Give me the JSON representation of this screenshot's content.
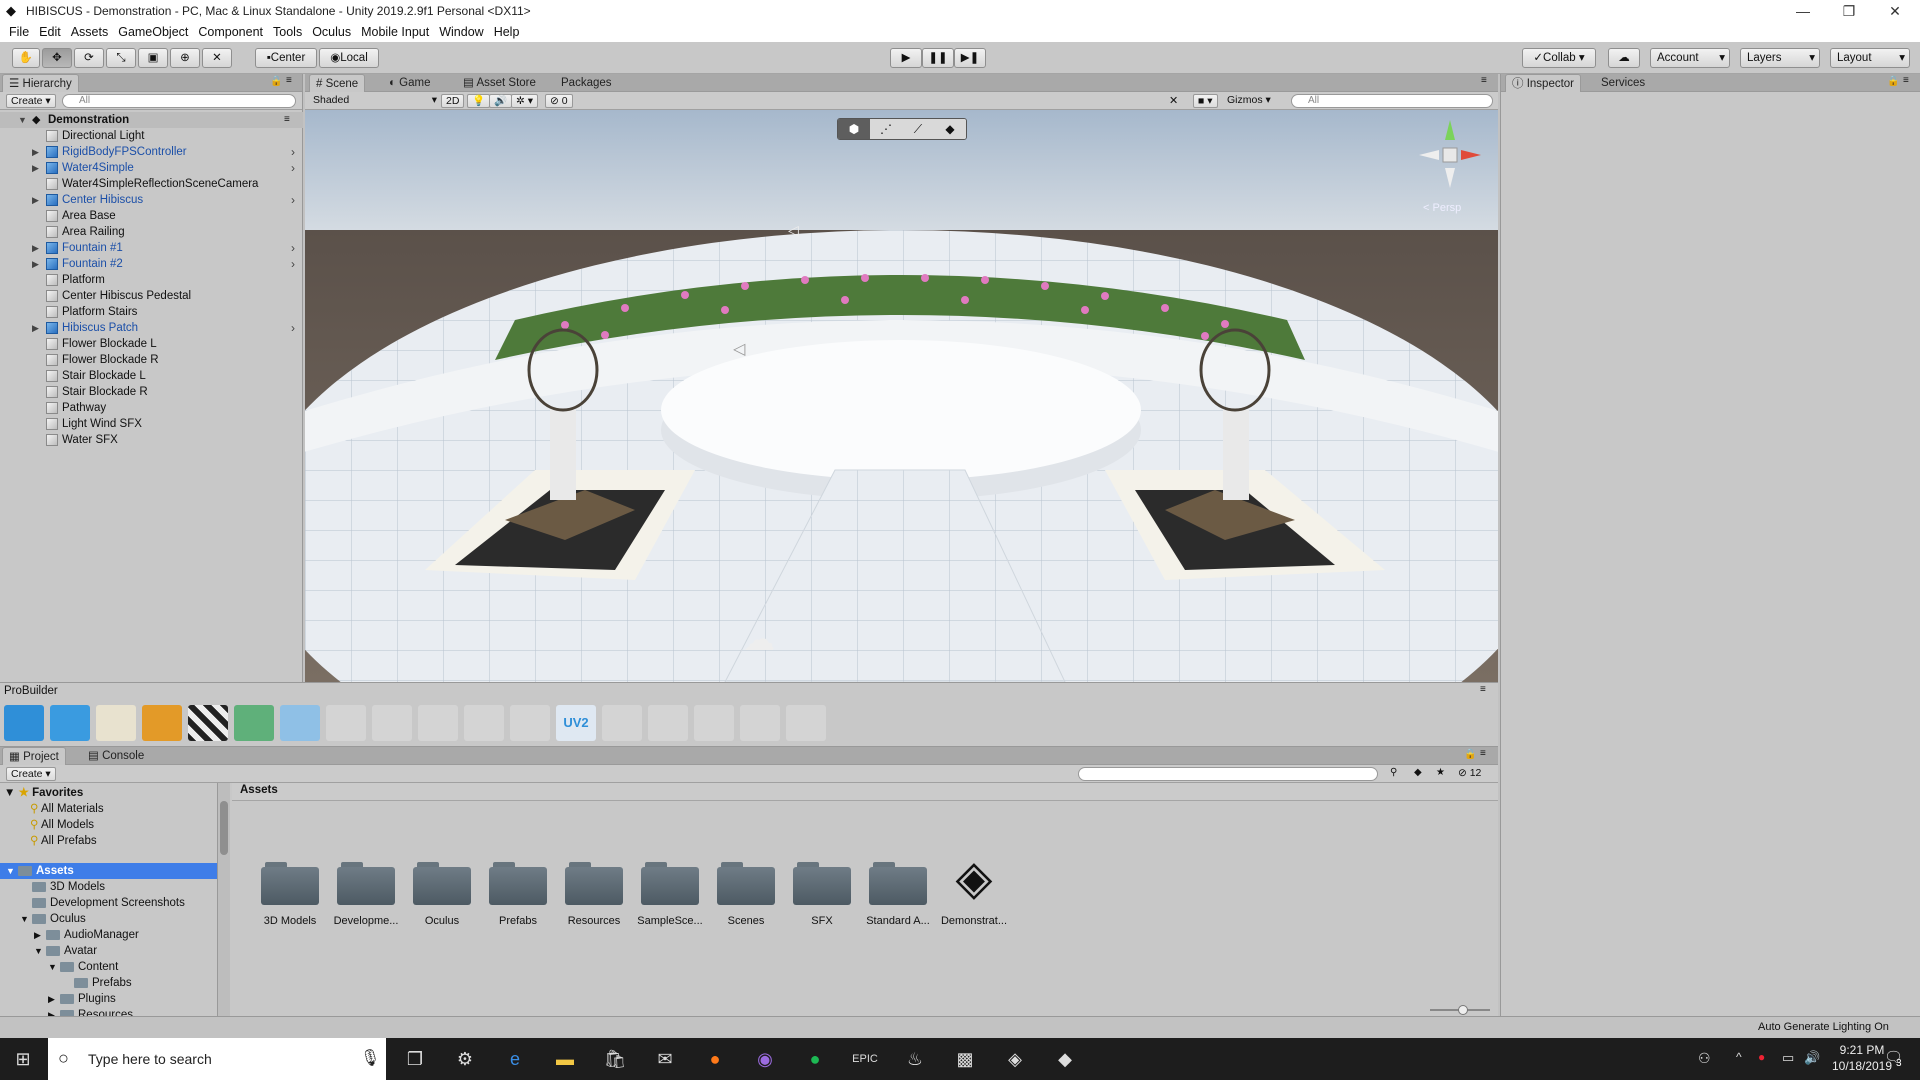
{
  "window": {
    "title": "HIBISCUS - Demonstration - PC, Mac & Linux Standalone - Unity 2019.2.9f1 Personal <DX11>"
  },
  "menu": [
    "File",
    "Edit",
    "Assets",
    "GameObject",
    "Component",
    "Tools",
    "Oculus",
    "Mobile Input",
    "Window",
    "Help"
  ],
  "toolbar": {
    "pivot": "Center",
    "space": "Local",
    "collab": "Collab",
    "account": "Account",
    "layers": "Layers",
    "layout": "Layout"
  },
  "hierarchy": {
    "tab": "Hierarchy",
    "create": "Create",
    "search_placeholder": "All",
    "scene": "Demonstration",
    "items": [
      {
        "label": "Directional Light",
        "prefab": false,
        "expand": false
      },
      {
        "label": "RigidBodyFPSController",
        "prefab": true,
        "expand": true
      },
      {
        "label": "Water4Simple",
        "prefab": true,
        "expand": true
      },
      {
        "label": "Water4SimpleReflectionSceneCamera",
        "prefab": false,
        "expand": false
      },
      {
        "label": "Center Hibiscus",
        "prefab": true,
        "expand": true
      },
      {
        "label": "Area Base",
        "prefab": false,
        "expand": false
      },
      {
        "label": "Area Railing",
        "prefab": false,
        "expand": false
      },
      {
        "label": "Fountain #1",
        "prefab": true,
        "expand": true
      },
      {
        "label": "Fountain #2",
        "prefab": true,
        "expand": true
      },
      {
        "label": "Platform",
        "prefab": false,
        "expand": false
      },
      {
        "label": "Center Hibiscus Pedestal",
        "prefab": false,
        "expand": false
      },
      {
        "label": "Platform Stairs",
        "prefab": false,
        "expand": false
      },
      {
        "label": "Hibiscus Patch",
        "prefab": true,
        "expand": true
      },
      {
        "label": "Flower Blockade L",
        "prefab": false,
        "expand": false
      },
      {
        "label": "Flower Blockade R",
        "prefab": false,
        "expand": false
      },
      {
        "label": "Stair Blockade L",
        "prefab": false,
        "expand": false
      },
      {
        "label": "Stair Blockade R",
        "prefab": false,
        "expand": false
      },
      {
        "label": "Pathway",
        "prefab": false,
        "expand": false
      },
      {
        "label": "Light Wind SFX",
        "prefab": false,
        "expand": false
      },
      {
        "label": "Water SFX",
        "prefab": false,
        "expand": false
      }
    ]
  },
  "scene_tabs": [
    "Scene",
    "Game",
    "Asset Store",
    "Packages"
  ],
  "scene_bar": {
    "shading": "Shaded",
    "mode2d": "2D",
    "fx_count": "0",
    "gizmos": "Gizmos",
    "search_placeholder": "All"
  },
  "scene_view": {
    "persp": "Persp"
  },
  "inspector_tabs": [
    "Inspector",
    "Services"
  ],
  "probuilder": {
    "title": "ProBuilder",
    "uv_label": "UV2"
  },
  "project": {
    "tabs": [
      "Project",
      "Console"
    ],
    "create": "Create",
    "visible_count": "12",
    "breadcrumb": "Assets",
    "favorites_label": "Favorites",
    "favorites": [
      "All Materials",
      "All Models",
      "All Prefabs"
    ],
    "tree": [
      {
        "label": "Assets",
        "depth": 0,
        "arrow": "open",
        "selected": true
      },
      {
        "label": "3D Models",
        "depth": 1,
        "arrow": "none"
      },
      {
        "label": "Development Screenshots",
        "depth": 1,
        "arrow": "none"
      },
      {
        "label": "Oculus",
        "depth": 1,
        "arrow": "open"
      },
      {
        "label": "AudioManager",
        "depth": 2,
        "arrow": "closed"
      },
      {
        "label": "Avatar",
        "depth": 2,
        "arrow": "open"
      },
      {
        "label": "Content",
        "depth": 3,
        "arrow": "open"
      },
      {
        "label": "Prefabs",
        "depth": 4,
        "arrow": "none"
      },
      {
        "label": "Plugins",
        "depth": 3,
        "arrow": "closed"
      },
      {
        "label": "Resources",
        "depth": 3,
        "arrow": "closed"
      }
    ],
    "assets": [
      "3D Models",
      "Developme...",
      "Oculus",
      "Prefabs",
      "Resources",
      "SampleSce...",
      "Scenes",
      "SFX",
      "Standard A...",
      "Demonstrat..."
    ]
  },
  "status": {
    "lighting": "Auto Generate Lighting On"
  },
  "taskbar": {
    "search_placeholder": "Type here to search",
    "time": "9:21 PM",
    "date": "10/18/2019",
    "notifications": "3"
  },
  "colors": {
    "selection": "#3e7de8",
    "prefab_blue": "#1b4fa8"
  }
}
